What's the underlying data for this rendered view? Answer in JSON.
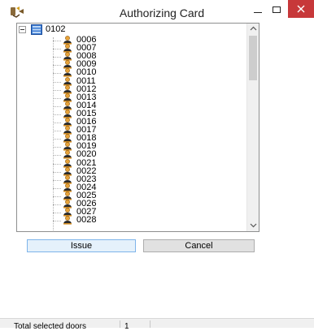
{
  "window": {
    "title": "Authorizing Card",
    "icon": "card-reader-icon",
    "controls": [
      "minimize-icon",
      "maximize-icon",
      "close-icon"
    ]
  },
  "tree": {
    "root": {
      "label": "0102",
      "expanded": true,
      "icon": "door-group-icon",
      "children": [
        "0006",
        "0007",
        "0008",
        "0009",
        "0010",
        "0011",
        "0012",
        "0013",
        "0014",
        "0015",
        "0016",
        "0017",
        "0018",
        "0019",
        "0020",
        "0021",
        "0022",
        "0023",
        "0024",
        "0025",
        "0026",
        "0027",
        "0028"
      ],
      "child_icon": "person-icon"
    },
    "scroll_position": 0.0
  },
  "buttons": {
    "issue": "Issue",
    "cancel": "Cancel"
  },
  "status": {
    "label": "Total selected doors",
    "value": "1"
  },
  "colors": {
    "close_button": "#c7383a",
    "issue_button_bg": "#e5f1fb",
    "issue_button_border": "#7eb4ea"
  }
}
